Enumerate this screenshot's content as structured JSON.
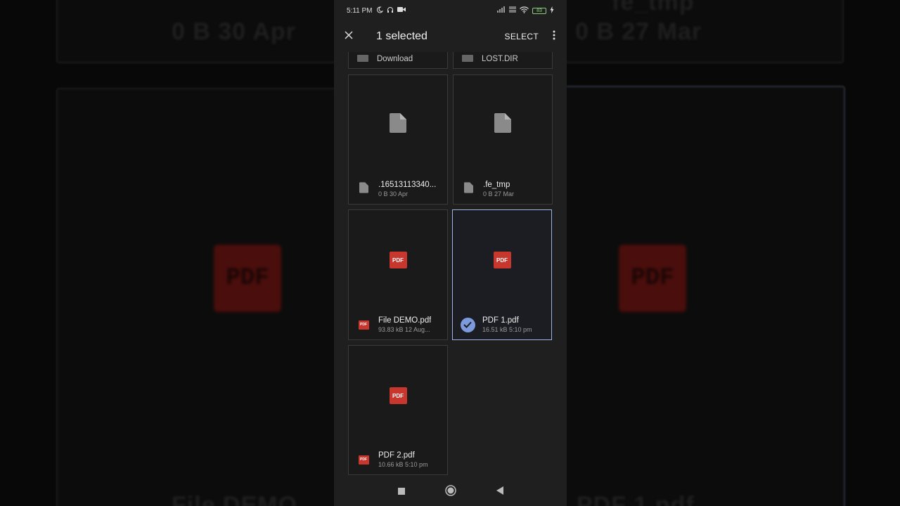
{
  "status_bar": {
    "time": "5:11 PM",
    "battery": "83"
  },
  "app_bar": {
    "title": "1 selected",
    "select_label": "SELECT"
  },
  "folders": [
    {
      "name": "Download"
    },
    {
      "name": "LOST.DIR"
    }
  ],
  "files": [
    {
      "name": ".16513113340...",
      "meta": "0 B 30 Apr",
      "type": "generic",
      "selected": false
    },
    {
      "name": ".fe_tmp",
      "meta": "0 B 27 Mar",
      "type": "generic",
      "selected": false
    },
    {
      "name": "File DEMO.pdf",
      "meta": "93.83 kB 12 Aug...",
      "type": "pdf",
      "selected": false
    },
    {
      "name": "PDF 1.pdf",
      "meta": "16.51 kB 5:10 pm",
      "type": "pdf",
      "selected": true
    },
    {
      "name": "PDF 2.pdf",
      "meta": "10.66 kB 5:10 pm",
      "type": "pdf",
      "selected": false
    }
  ],
  "pdf_badge": "PDF",
  "background_mirror": {
    "top_left_meta": "0 B 30 Apr",
    "top_right_meta": "0 B 27 Mar",
    "top_right_name": "fe_tmp",
    "bottom_left_name": "File DEMO",
    "bottom_right_name": "PDF 1.pdf"
  },
  "icons": [
    "close-icon",
    "more-vert-icon",
    "file-icon",
    "folder-icon",
    "pdf-icon",
    "check-circle-icon",
    "recents-nav-icon",
    "home-nav-icon",
    "back-nav-icon"
  ],
  "colors": {
    "accent": "#7d9bdc",
    "pdf_red": "#c8372d",
    "surface": "#1f1f1f"
  }
}
